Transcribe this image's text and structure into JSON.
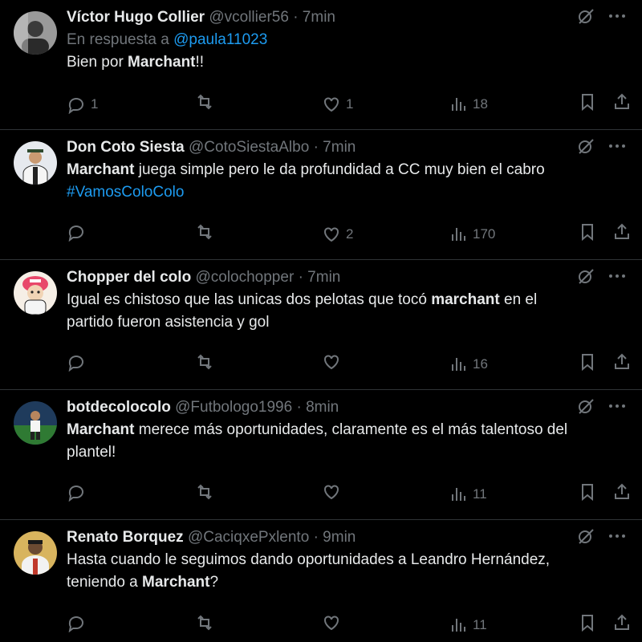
{
  "tweets": [
    {
      "name": "Víctor Hugo Collier",
      "handle": "@vcollier56",
      "separator": "·",
      "time": "7min",
      "reply_prefix": "En respuesta a ",
      "reply_mention": "@paula11023",
      "text": [
        {
          "t": "Bien por "
        },
        {
          "t": "Marchant",
          "b": true
        },
        {
          "t": "!!"
        }
      ],
      "replies": "1",
      "retweets": "",
      "likes": "1",
      "views": "18",
      "avatar_color": "#6b6b6b"
    },
    {
      "name": "Don Coto Siesta",
      "handle": "@CotoSiestaAlbo",
      "separator": "·",
      "time": "7min",
      "text": [
        {
          "t": "Marchant",
          "b": true
        },
        {
          "t": " juega simple pero le da profundidad a CC muy bien el cabro"
        },
        {
          "br": true
        },
        {
          "t": "#VamosColoColo",
          "h": true
        }
      ],
      "replies": "",
      "retweets": "",
      "likes": "2",
      "views": "170",
      "avatar_color": "#d9dde2"
    },
    {
      "name": "Chopper del colo",
      "handle": "@colochopper",
      "separator": "·",
      "time": "7min",
      "text": [
        {
          "t": "Igual es chistoso que las unicas dos pelotas que tocó "
        },
        {
          "t": "marchant",
          "b": true
        },
        {
          "t": " en el"
        },
        {
          "br": true
        },
        {
          "t": "partido fueron asistencia y gol"
        }
      ],
      "replies": "",
      "retweets": "",
      "likes": "",
      "views": "16",
      "avatar_color": "#f2e6d9"
    },
    {
      "name": "botdecolocolo",
      "handle": "@Futbologo1996",
      "separator": "·",
      "time": "8min",
      "text": [
        {
          "t": "Marchant",
          "b": true
        },
        {
          "t": " merece más oportunidades, claramente es el más talentoso del"
        },
        {
          "br": true
        },
        {
          "t": "plantel!"
        }
      ],
      "replies": "",
      "retweets": "",
      "likes": "",
      "views": "11",
      "avatar_color": "#2e5a2e"
    },
    {
      "name": "Renato Borquez",
      "handle": "@CaciqxePxlento",
      "separator": "·",
      "time": "9min",
      "text": [
        {
          "t": "Hasta cuando le seguimos dando oportunidades a Leandro Hernández,"
        },
        {
          "br": true
        },
        {
          "t": "teniendo a "
        },
        {
          "t": "Marchant",
          "b": true
        },
        {
          "t": "?"
        }
      ],
      "replies": "",
      "retweets": "",
      "likes": "",
      "views": "11",
      "avatar_color": "#c9a25a"
    }
  ],
  "icons": {
    "reply": "reply-icon",
    "retweet": "retweet-icon",
    "like": "heart-icon",
    "views": "views-icon",
    "bookmark": "bookmark-icon",
    "share": "share-icon",
    "grok": "grok-icon",
    "more": "more-icon"
  },
  "colors": {
    "background": "#000000",
    "text": "#e7e9ea",
    "muted": "#71767b",
    "link": "#1d9bf0",
    "divider": "#2f3336"
  }
}
